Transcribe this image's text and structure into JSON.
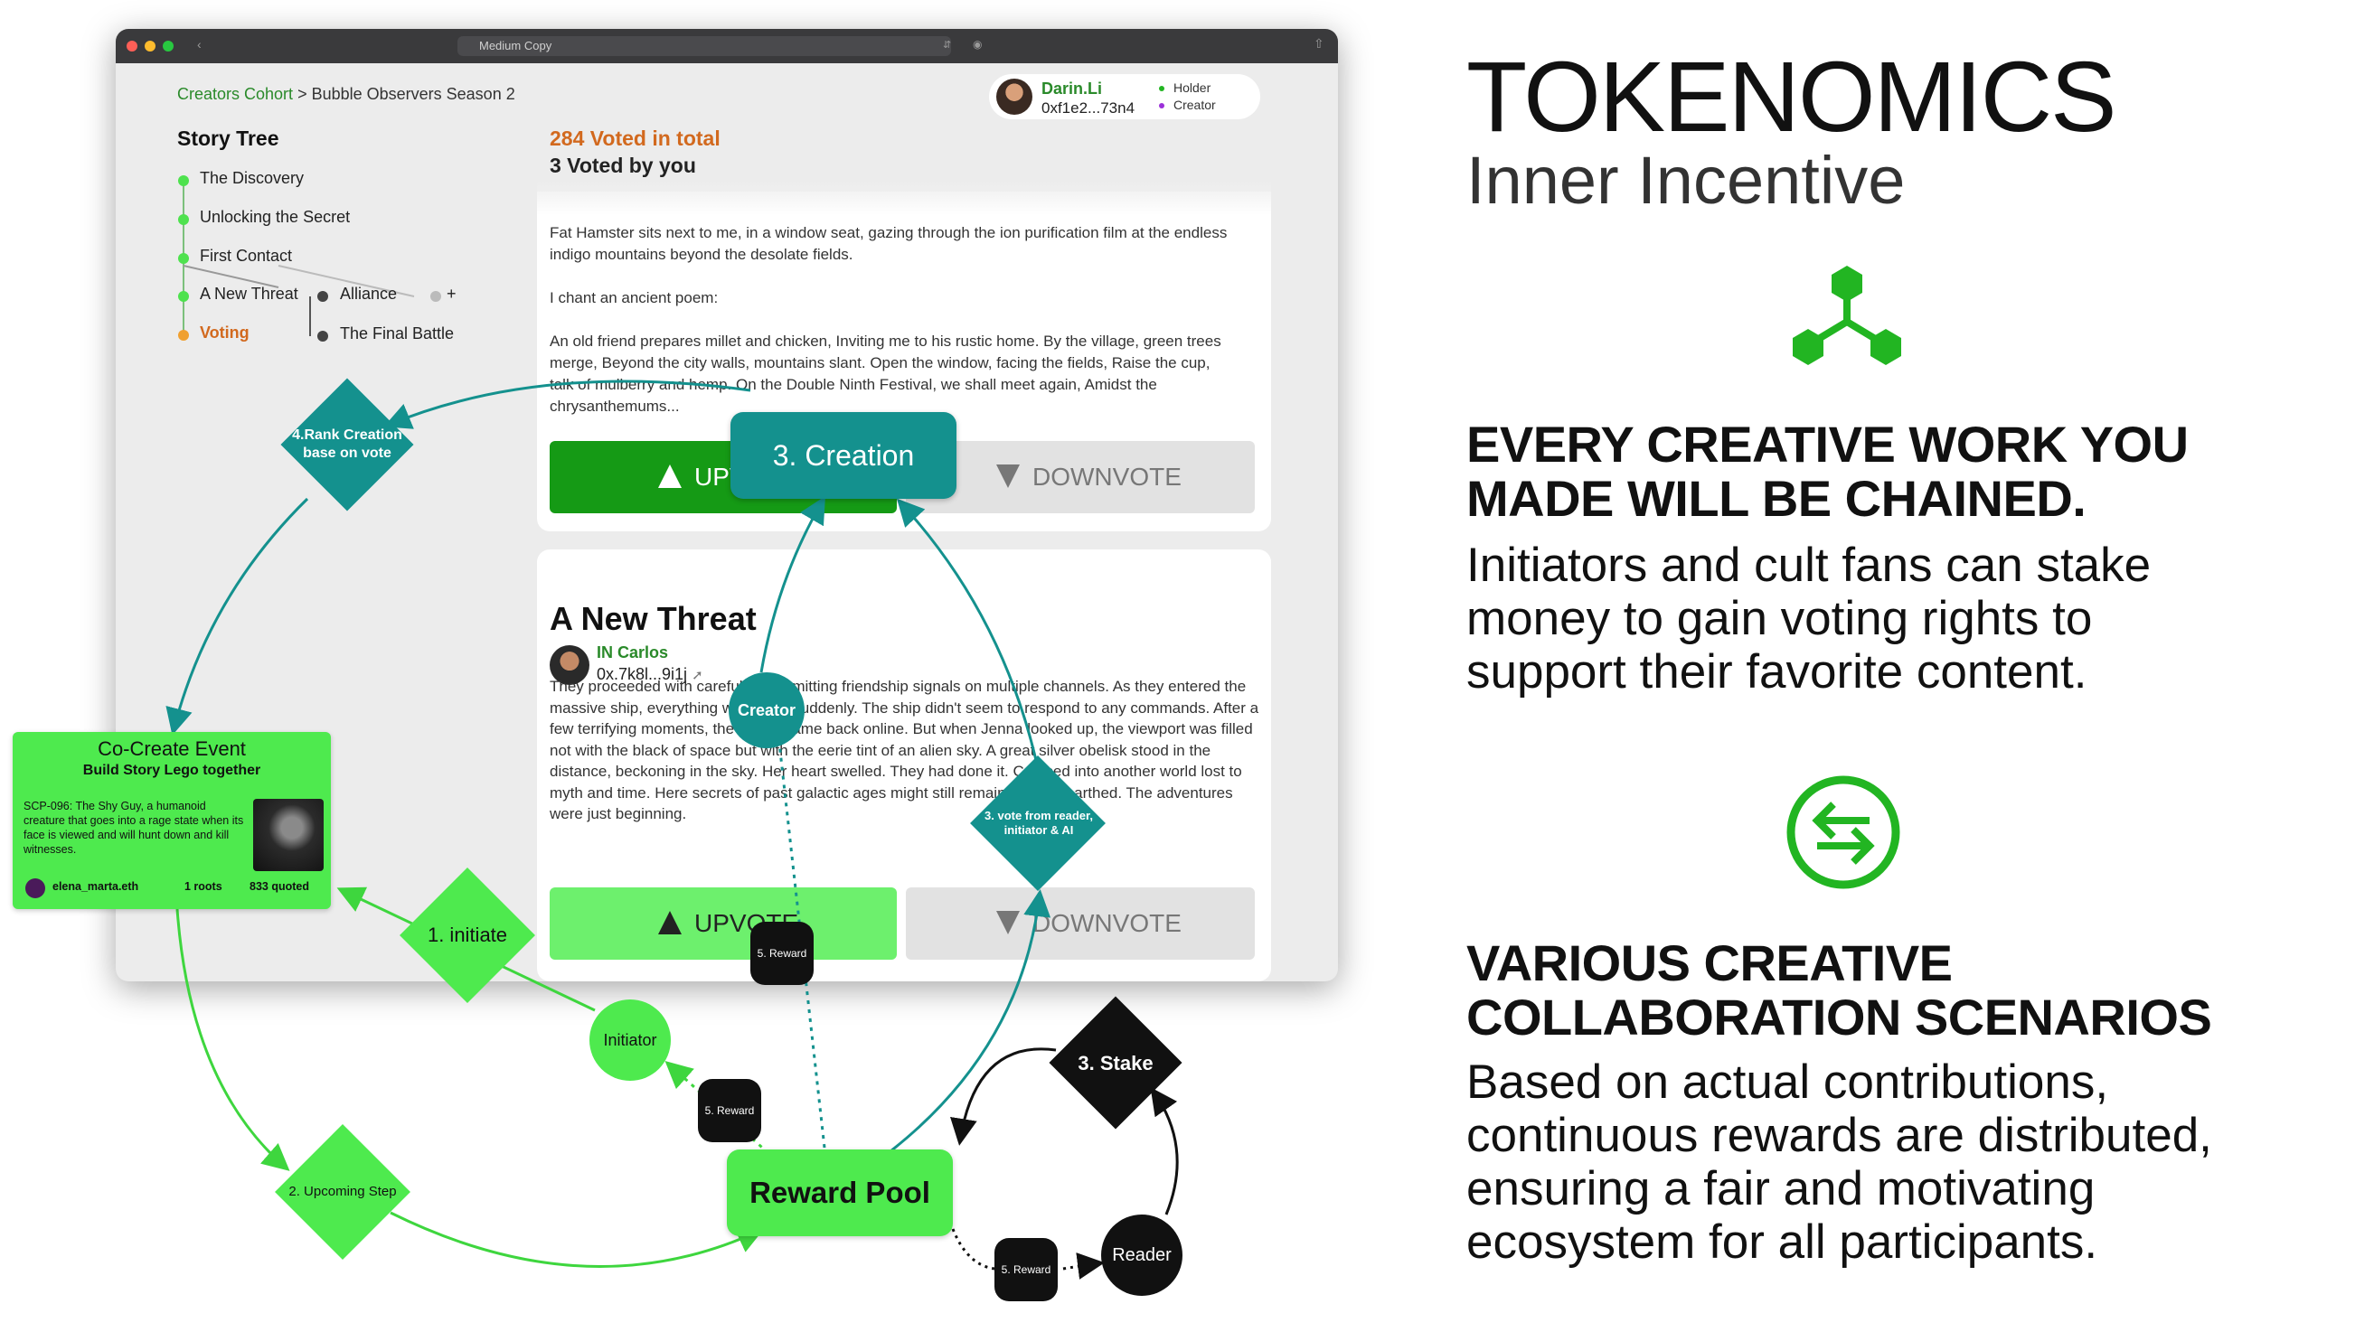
{
  "browser": {
    "address": "Medium Copy"
  },
  "app": {
    "breadcrumb_root": "Creators Cohort",
    "breadcrumb_sep": " > ",
    "breadcrumb_current": "Bubble Observers Season 2",
    "user": {
      "name": "Darin.Li",
      "address": "0xf1e2...73n4",
      "roles": [
        "Holder",
        "Creator"
      ],
      "role_colors": [
        "#22b522",
        "#9b30d9"
      ]
    },
    "story_tree": {
      "title": "Story Tree",
      "items": [
        "The Discovery",
        "Unlocking the Secret",
        "First Contact",
        "A New Threat",
        "Voting"
      ],
      "branch_items": [
        "Alliance",
        "+",
        "The Final Battle"
      ]
    },
    "votes_total": "284 Voted in total",
    "votes_you": "3 Voted by you",
    "card1": {
      "paragraphs": [
        "Fat Hamster sits next to me, in a window seat, gazing through the ion purification film at the endless indigo mountains beyond the desolate fields.",
        "I chant an ancient poem:",
        "An old friend prepares millet and chicken, Inviting me to his rustic home. By the village, green trees merge, Beyond the city walls, mountains slant. Open the window, facing the fields, Raise the cup, talk of mulberry and hemp. On the Double Ninth Festival, we shall meet again, Amidst the chrysanthemums..."
      ],
      "upvote": "UPVOTE",
      "downvote": "DOWNVOTE"
    },
    "card2": {
      "title": "A New Threat",
      "author": "IN Carlos",
      "author_address": "0x.7k8l...9i1j",
      "text": "They proceeded with carefully transmitting friendship signals on multiple channels. As they entered the massive ship, everything went dark suddenly. The ship didn't seem to respond to any commands. After a few terrifying moments, the power came back online. But when Jenna looked up, the viewport was filled not with the black of space but with the eerie tint of an alien sky. A great silver obelisk stood in the distance, beckoning in the sky. Her heart swelled. They had done it. Crossed into another world lost to myth and time. Here secrets of past galactic ages might still remain to be unearthed. The adventures were just beginning.",
      "upvote": "UPVOTE",
      "downvote": "DOWNVOTE"
    }
  },
  "diagram": {
    "rank": "4.Rank Creation base on vote",
    "creation": "3. Creation",
    "creator": "Creator",
    "vote": "3. vote from reader, initiator & AI",
    "initiate": "1. initiate",
    "initiator": "Initiator",
    "upcoming": "2. Upcoming Step",
    "reward_pool": "Reward Pool",
    "reward": "5. Reward",
    "stake": "3. Stake",
    "reader": "Reader",
    "cocreate": {
      "title": "Co-Create Event",
      "subtitle": "Build Story Lego together",
      "description": "SCP-096: The Shy Guy, a humanoid creature that goes into a rage state when its face is viewed and will hunt down and kill witnesses.",
      "author": "elena_marta.eth",
      "roots": "1 roots",
      "quoted": "833 quoted"
    }
  },
  "panel": {
    "title": "TOKENOMICS",
    "subtitle": "Inner Incentive",
    "section1_heading_1": "EVERY CREATIVE WORK YOU",
    "section1_heading_2": "MADE WILL BE CHAINED.",
    "section1_body_1": "Initiators and cult fans can stake",
    "section1_body_2": "money to gain voting rights to",
    "section1_body_3": "support their favorite content.",
    "section2_heading_1": "VARIOUS CREATIVE",
    "section2_heading_2": "COLLABORATION SCENARIOS",
    "section2_body_1": "Based on actual contributions,",
    "section2_body_2": "continuous rewards are distributed,",
    "section2_body_3": "ensuring a fair and motivating",
    "section2_body_4": "ecosystem for all participants."
  },
  "colors": {
    "accent_green": "#22b522",
    "bright_green": "#4eea4e",
    "teal": "#14918e",
    "vote_orange": "#d2691e",
    "dark_upvote": "#159a15",
    "light_upvote": "#6df06d"
  },
  "icons": [
    "network-icon",
    "exchange-icon",
    "up-triangle-icon",
    "down-triangle-icon"
  ]
}
